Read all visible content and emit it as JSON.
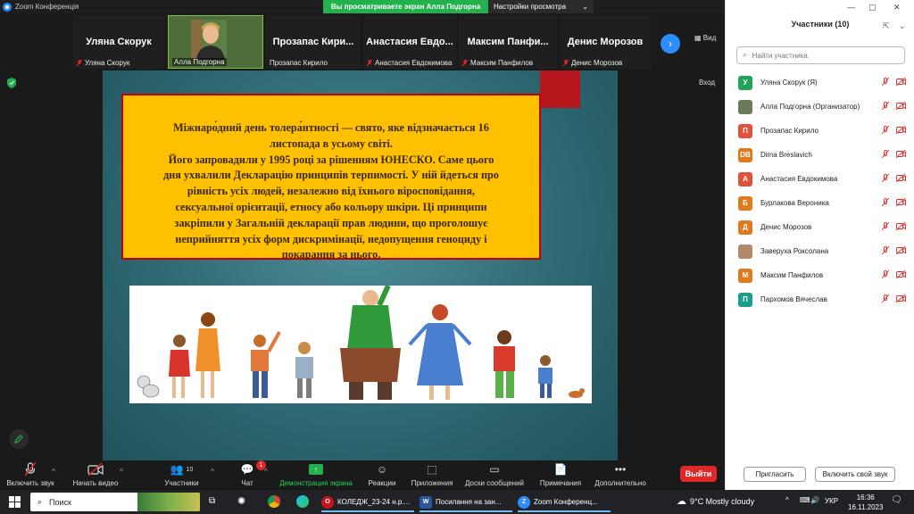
{
  "window": {
    "title": "Zoom Конференція"
  },
  "share_banner": {
    "viewing_text": "Вы просматриваете экран Алла Подгорна",
    "view_settings": "Настройки просмотра"
  },
  "strip": {
    "thumbs": [
      {
        "big": "Уляна Скорук",
        "small": "Уляна Скорук"
      },
      {
        "big": "",
        "small": "Алла Подгорна"
      },
      {
        "big": "Прозапас Кири...",
        "small": "Прозапас Кирило"
      },
      {
        "big": "Анастасия Евдо...",
        "small": "Анастасия Евдокимова"
      },
      {
        "big": "Максим Панфи...",
        "small": "Максим Панфилов"
      },
      {
        "big": "Денис Морозов",
        "small": "Денис Морозов"
      }
    ],
    "view_label": "Вид"
  },
  "share": {
    "exit_label": "Вход",
    "slide_text": [
      "Міжнаро́дний день толера́нтності — свято, яке відзначається 16",
      "листопада в усьому світі.",
      "Його запровадили у 1995 році за рішенням ЮНЕСКО. Саме цього",
      "дня ухвалили Декларацію принципів терпимості. У ній йдеться про",
      "рівність усіх людей, незалежно від їхнього віросповідання,",
      "сексуальної орієнтації, етносу або кольору шкіри. Ці принципи",
      "закріпили у Загальній декларації прав людини, що проголошує",
      "неприйняття усіх форм дискримінації, недопущення геноциду і",
      "покарання за нього."
    ]
  },
  "toolbar": {
    "unmute": "Включить звук",
    "start_video": "Начать видео",
    "participants": "Участники",
    "participants_count": "10",
    "chat": "Чат",
    "chat_badge": "1",
    "share_screen": "Демонстрация экрана",
    "reactions": "Реакции",
    "apps": "Приложения",
    "whiteboards": "Доски сообщений",
    "notes": "Примечания",
    "more": "Дополнительно",
    "leave": "Выйти"
  },
  "panel": {
    "title": "Участники (10)",
    "search_placeholder": "Найти участника",
    "participants": [
      {
        "initials": "У",
        "name": "Уляна Скорук (Я)",
        "color": "#22a35a"
      },
      {
        "initials": "",
        "name": "Алла Подгорна (Организатор)",
        "color": "#6a7a5a"
      },
      {
        "initials": "П",
        "name": "Прозапас Кирило",
        "color": "#e0533a"
      },
      {
        "initials": "DB",
        "name": "Dima Breslavich",
        "color": "#e07a1f"
      },
      {
        "initials": "А",
        "name": "Анастасия Евдокимова",
        "color": "#e0533a"
      },
      {
        "initials": "Б",
        "name": "Бурлакова Вероника",
        "color": "#e07a1f"
      },
      {
        "initials": "Д",
        "name": "Денис Морозов",
        "color": "#e07a1f"
      },
      {
        "initials": "",
        "name": "Заверуха Роксолана",
        "color": "#b08a6a"
      },
      {
        "initials": "М",
        "name": "Максим Панфилов",
        "color": "#e07a1f"
      },
      {
        "initials": "П",
        "name": "Пархомов Вячеслав",
        "color": "#1a9e8a"
      }
    ],
    "invite": "Пригласить",
    "unmute_me": "Включить свой звук"
  },
  "taskbar": {
    "search": "Поиск",
    "apps": [
      {
        "label": "КОЛЕДЖ_23-24 н.р....",
        "color": "#c4161c",
        "glyph": "O"
      },
      {
        "label": "Посилання на зан...",
        "color": "#2b579a",
        "glyph": "W"
      },
      {
        "label": "Zoom Конференц...",
        "color": "#2d8cff",
        "glyph": "Z"
      }
    ],
    "weather": "9°C  Mostly cloudy",
    "lang": "УКР",
    "time": "16:36",
    "date": "16.11.2023"
  }
}
